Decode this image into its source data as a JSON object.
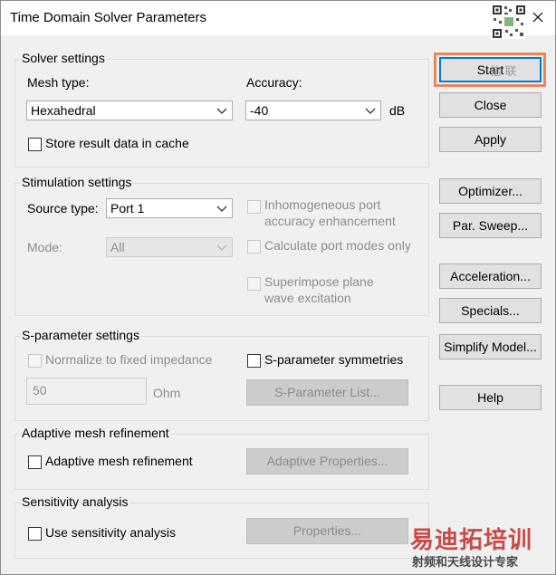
{
  "window": {
    "title": "Time Domain Solver Parameters"
  },
  "solver": {
    "group_title": "Solver settings",
    "mesh_label": "Mesh type:",
    "mesh_value": "Hexahedral",
    "accuracy_label": "Accuracy:",
    "accuracy_value": "-40",
    "accuracy_unit": "dB",
    "store_cache_label": "Store result data in cache"
  },
  "stimulation": {
    "group_title": "Stimulation settings",
    "source_label": "Source type:",
    "source_value": "Port 1",
    "mode_label": "Mode:",
    "mode_value": "All",
    "inhomo_line1": "Inhomogeneous port",
    "inhomo_line2": "accuracy enhancement",
    "calc_modes_label": "Calculate port modes only",
    "superimpose_line1": "Superimpose plane",
    "superimpose_line2": "wave excitation"
  },
  "sparam": {
    "group_title": "S-parameter settings",
    "normalize_label": "Normalize to fixed impedance",
    "impedance_value": "50",
    "ohm_label": "Ohm",
    "symmetries_label": "S-parameter symmetries",
    "list_button": "S-Parameter List..."
  },
  "adaptive": {
    "group_title": "Adaptive mesh refinement",
    "checkbox_label": "Adaptive mesh refinement",
    "properties_button": "Adaptive Properties..."
  },
  "sensitivity": {
    "group_title": "Sensitivity analysis",
    "checkbox_label": "Use sensitivity analysis",
    "properties_button": "Properties..."
  },
  "buttons": {
    "start": "Start",
    "close": "Close",
    "apply": "Apply",
    "optimizer": "Optimizer...",
    "par_sweep": "Par. Sweep...",
    "acceleration": "Acceleration...",
    "specials": "Specials...",
    "simplify_model": "Simplify Model...",
    "help": "Help"
  },
  "watermark": {
    "brand": "易迪拓培训",
    "tagline": "射频和天线设计专家",
    "small": "信 联"
  },
  "colors": {
    "accent": "#0078d7",
    "focus_highlight": "#e8875a",
    "watermark_red": "#c84a4a"
  },
  "icons": {
    "close": "close-icon",
    "dropdown": "chevron-down-icon",
    "qr": "qr-code"
  }
}
